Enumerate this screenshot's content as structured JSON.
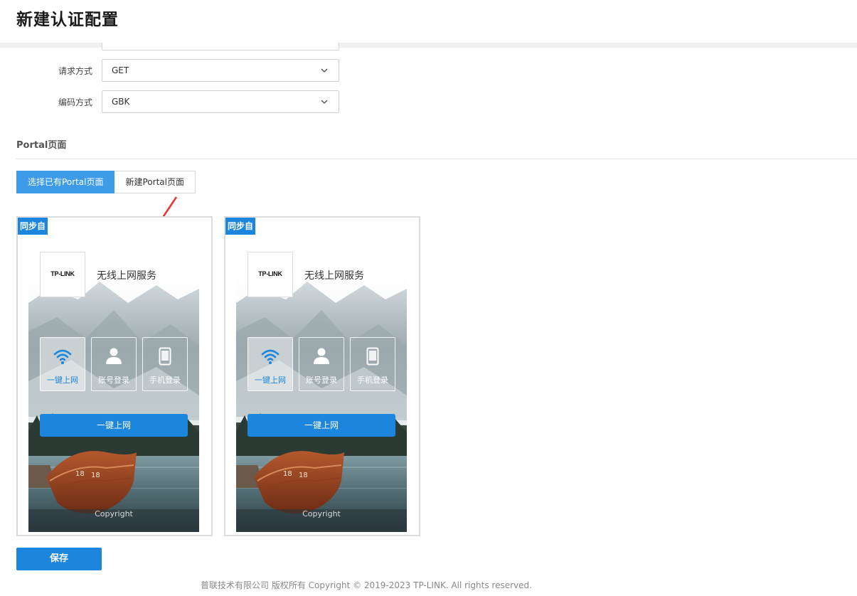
{
  "page": {
    "title": "新建认证配置"
  },
  "form": {
    "request_method": {
      "label": "请求方式",
      "value": "GET"
    },
    "encoding": {
      "label": "编码方式",
      "value": "GBK"
    }
  },
  "portal": {
    "section_title": "Portal页面",
    "tabs": [
      {
        "label": "选择已有Portal页面",
        "active": true
      },
      {
        "label": "新建Portal页面",
        "active": false
      }
    ],
    "cards": [
      {
        "badge": "同步自",
        "logo": "TP-LINK",
        "service_title": "无线上网服务",
        "options": [
          {
            "label": "一键上网",
            "icon": "wifi-icon"
          },
          {
            "label": "账号登录",
            "icon": "user-icon"
          },
          {
            "label": "手机登录",
            "icon": "phone-icon"
          }
        ],
        "login_button": "一键上网",
        "copyright": "Copyright"
      },
      {
        "badge": "同步自",
        "logo": "TP-LINK",
        "service_title": "无线上网服务",
        "options": [
          {
            "label": "一键上网",
            "icon": "wifi-icon"
          },
          {
            "label": "账号登录",
            "icon": "user-icon"
          },
          {
            "label": "手机登录",
            "icon": "phone-icon"
          }
        ],
        "login_button": "一键上网",
        "copyright": "Copyright"
      }
    ]
  },
  "actions": {
    "save_label": "保存"
  },
  "footer": {
    "text": "普联技术有限公司 版权所有 Copyright © 2019-2023 TP-LINK. All rights reserved."
  },
  "colors": {
    "accent": "#1c86de",
    "tab_active": "#3d9be9",
    "annotation_arrow": "#e8373a"
  }
}
